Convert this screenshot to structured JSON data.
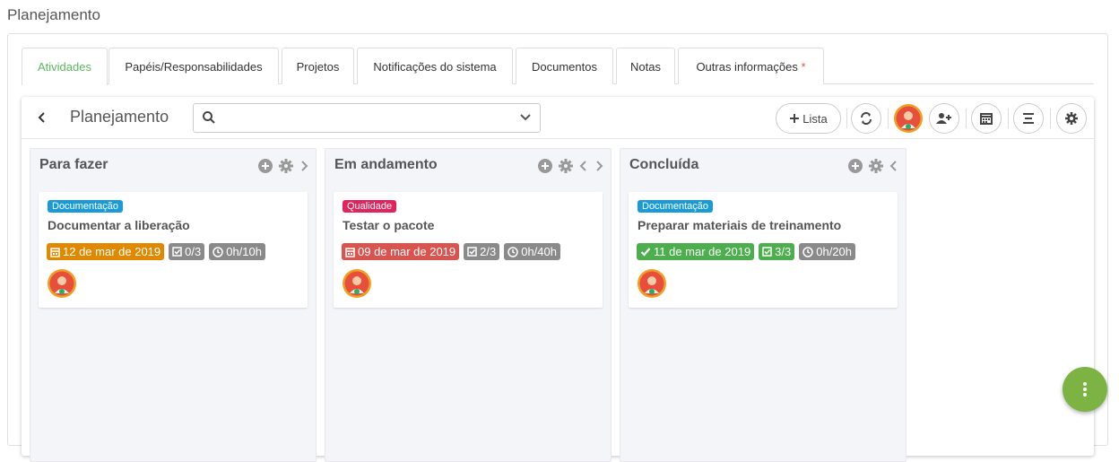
{
  "page": {
    "title": "Planejamento"
  },
  "tabs": [
    {
      "label": "Atividades"
    },
    {
      "label": "Papéis/Responsabilidades"
    },
    {
      "label": "Projetos"
    },
    {
      "label": "Notificações do sistema"
    },
    {
      "label": "Documentos"
    },
    {
      "label": "Notas"
    },
    {
      "label": "Outras informações",
      "marker": "*"
    }
  ],
  "board": {
    "title": "Planejamento",
    "search_value": "",
    "lista_label": "Lista"
  },
  "columns": [
    {
      "title": "Para fazer",
      "card": {
        "tag": "Documentação",
        "tag_color": "#1a9bd7",
        "title": "Documentar a liberação",
        "date": "12 de mar de 2019",
        "date_color": "#e08900",
        "checklist": "0/3",
        "checklist_color": "#8a8a8a",
        "time": "0h/10h"
      }
    },
    {
      "title": "Em andamento",
      "card": {
        "tag": "Qualidade",
        "tag_color": "#e0245e",
        "title": "Testar o pacote",
        "date": "09 de mar de 2019",
        "date_color": "#d9534f",
        "checklist": "2/3",
        "checklist_color": "#8a8a8a",
        "time": "0h/40h"
      }
    },
    {
      "title": "Concluída",
      "card": {
        "tag": "Documentação",
        "tag_color": "#1a9bd7",
        "title": "Preparar materiais de treinamento",
        "date": "11 de mar de 2019",
        "date_color": "#4cae4c",
        "checklist": "3/3",
        "checklist_color": "#4cae4c",
        "time": "0h/20h"
      }
    }
  ],
  "colors": {
    "accent": "#5cb85c",
    "fab": "#7cb342"
  }
}
